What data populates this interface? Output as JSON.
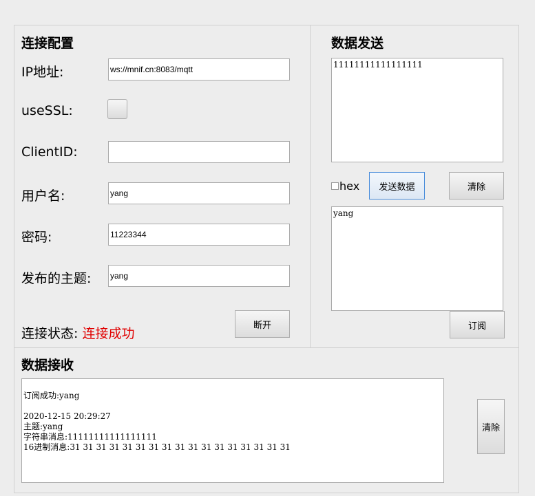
{
  "connection": {
    "heading": "连接配置",
    "ip_label": "IP地址:",
    "ip_value": "ws://mnif.cn:8083/mqtt",
    "ssl_label": "useSSL:",
    "clientid_label": "ClientID:",
    "clientid_value": "",
    "username_label": "用户名:",
    "username_value": "yang",
    "password_label": "密码:",
    "password_value": "11223344",
    "topic_label": "发布的主题:",
    "topic_value": "yang",
    "status_label": "连接状态: ",
    "status_value": "连接成功",
    "status_color": "#e00000",
    "disconnect_label": "断开"
  },
  "send": {
    "heading": "数据发送",
    "message_text": "11111111111111111",
    "hex_label": "hex",
    "send_label": "发送数据",
    "clear_label": "清除",
    "subscribe_text": "yang",
    "subscribe_label": "订阅"
  },
  "receive": {
    "heading": "数据接收",
    "log_text": "\n订阅成功:yang\n\n2020-12-15 20:29:27\n主题:yang\n字符串消息:11111111111111111\n16进制消息:31 31 31 31 31 31 31 31 31 31 31 31 31 31 31 31 31",
    "clear_label": "清除"
  }
}
